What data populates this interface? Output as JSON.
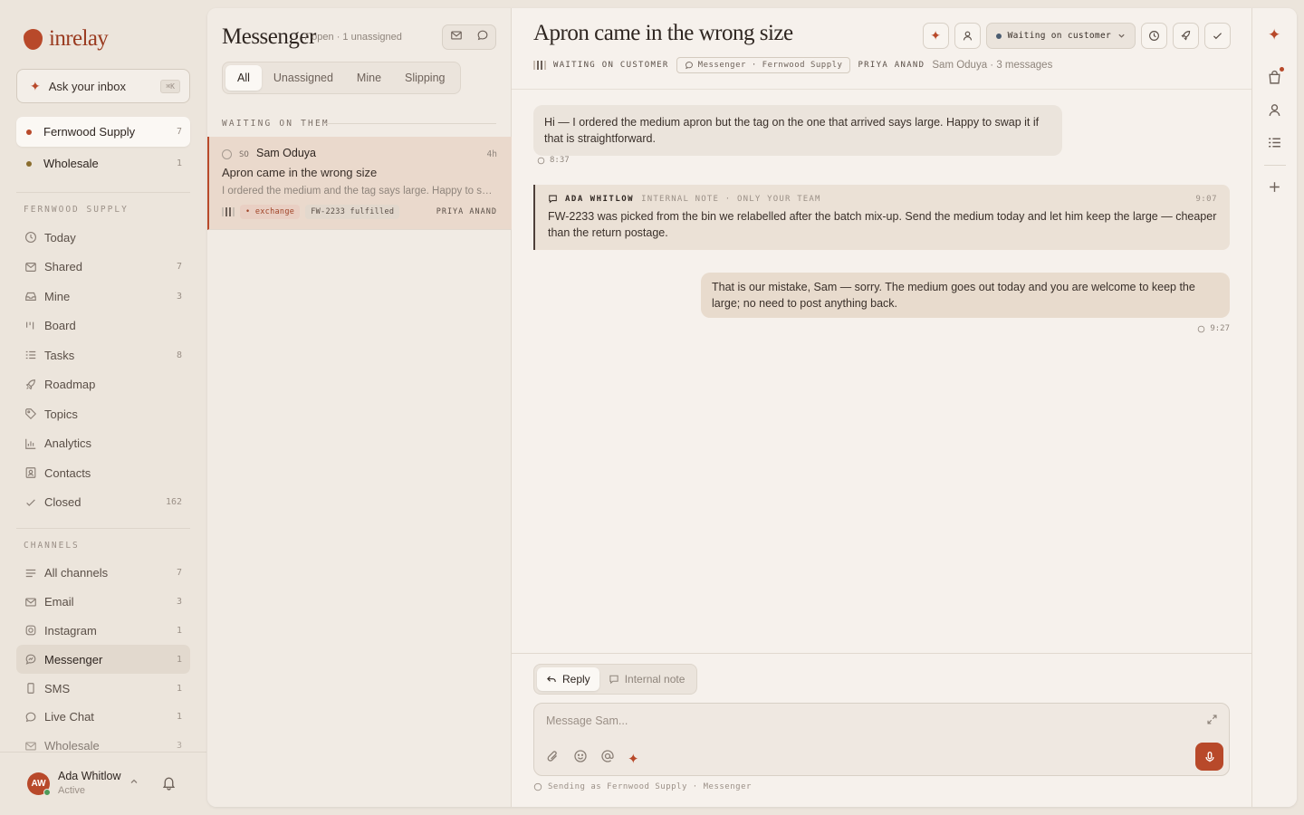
{
  "brand": {
    "name": "inrelay",
    "accent": "#b8492a"
  },
  "ask": {
    "label": "Ask your inbox",
    "shortcut": "⌘K"
  },
  "workspaces": [
    {
      "label": "Fernwood Supply",
      "count": "7",
      "dot_color": "#b8492a",
      "active": true
    },
    {
      "label": "Wholesale",
      "count": "1",
      "dot_color": "#8a6d2e",
      "active": false
    }
  ],
  "sections": {
    "workspace": "FERNWOOD SUPPLY",
    "channels": "CHANNELS"
  },
  "nav": [
    {
      "label": "Today",
      "count": "",
      "icon": "clock-icon"
    },
    {
      "label": "Shared",
      "count": "7",
      "icon": "inbox-icon"
    },
    {
      "label": "Mine",
      "count": "3",
      "icon": "tray-icon"
    },
    {
      "label": "Board",
      "count": "",
      "icon": "board-icon"
    },
    {
      "label": "Tasks",
      "count": "8",
      "icon": "tasks-icon"
    },
    {
      "label": "Roadmap",
      "count": "",
      "icon": "rocket-icon"
    },
    {
      "label": "Topics",
      "count": "",
      "icon": "tag-icon"
    },
    {
      "label": "Analytics",
      "count": "",
      "icon": "chart-icon"
    },
    {
      "label": "Contacts",
      "count": "",
      "icon": "contact-icon"
    },
    {
      "label": "Closed",
      "count": "162",
      "icon": "check-icon"
    }
  ],
  "channels": [
    {
      "label": "All channels",
      "count": "7",
      "icon": "list-icon"
    },
    {
      "label": "Email",
      "count": "3",
      "icon": "mail-icon"
    },
    {
      "label": "Instagram",
      "count": "1",
      "icon": "instagram-icon"
    },
    {
      "label": "Messenger",
      "count": "1",
      "icon": "messenger-icon"
    },
    {
      "label": "SMS",
      "count": "1",
      "icon": "phone-icon"
    },
    {
      "label": "Live Chat",
      "count": "1",
      "icon": "chat-icon"
    },
    {
      "label": "Wholesale",
      "count": "3",
      "icon": "mail-icon"
    }
  ],
  "user": {
    "initials": "AW",
    "name": "Ada Whitlow",
    "status": "Active"
  },
  "list": {
    "title": "Messenger",
    "subtitle": "7 open · 1 unassigned",
    "filters": [
      "All",
      "Unassigned",
      "Mine",
      "Slipping"
    ],
    "group_label": "WAITING ON THEM",
    "conversation": {
      "initials": "SO",
      "name": "Sam Oduya",
      "age": "4h",
      "subject": "Apron came in the wrong size",
      "preview": "I ordered the medium and the tag says large. Happy to swap it if that is straightforward.",
      "tags": [
        "• exchange",
        "FW-2233 fulfilled"
      ],
      "assignee": "PRIYA ANAND"
    }
  },
  "thread": {
    "title": "Apron came in the wrong size",
    "status_label": "WAITING ON CUSTOMER",
    "channel_chip": "Messenger · Fernwood Supply",
    "assignee": "PRIYA ANAND",
    "summary": "Sam Oduya · 3 messages",
    "status_dropdown": "Waiting on customer",
    "messages": {
      "inbound": {
        "text": "Hi — I ordered the medium apron but the tag on the one that arrived says large. Happy to swap it if that is straightforward.",
        "time": "8:37"
      },
      "note": {
        "author": "ADA WHITLOW",
        "kind": "INTERNAL NOTE · ONLY YOUR TEAM",
        "time": "9:07",
        "text": "FW-2233 was picked from the bin we relabelled after the batch mix-up. Send the medium today and let him keep the large — cheaper than the return postage."
      },
      "outbound": {
        "text": "That is our mistake, Sam — sorry. The medium goes out today and you are welcome to keep the large; no need to post anything back.",
        "time": "9:27"
      }
    },
    "composer": {
      "tab_reply": "Reply",
      "tab_note": "Internal note",
      "placeholder": "Message Sam...",
      "sending_as": "Sending as Fernwood Supply · Messenger"
    }
  }
}
